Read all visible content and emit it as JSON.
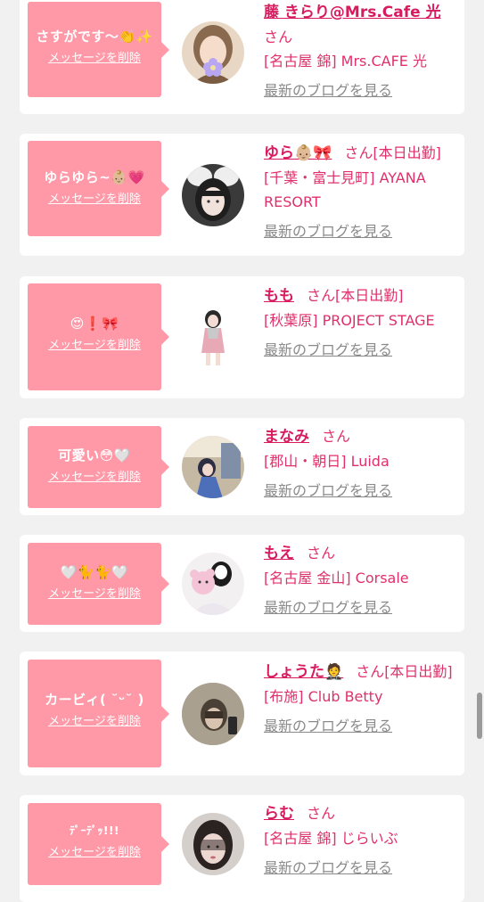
{
  "theme": {
    "bubble_color": "#ff99a8",
    "name_color": "#d81b5f",
    "text_color": "#e0306c",
    "link_gray": "#8a8a8a",
    "page_bg": "#f1f1f1"
  },
  "delete_label": "メッセージを削除",
  "blog_label": "最新のブログを見る",
  "cards": [
    {
      "message": "さすがです〜👏✨",
      "name": "藤 きらり@Mrs.Cafe 光",
      "san": "さん",
      "status": "",
      "shop": "[名古屋 錦] Mrs.CAFE 光",
      "avatar_icon": "girl-face-with-flower-sticker"
    },
    {
      "message": "ゆらゆら~👶🏼💗",
      "name": "ゆら👶🏼🎀",
      "san": "さん",
      "status": "[本日出勤]",
      "shop": "[千葉・富士見町] AYANA RESORT",
      "avatar_icon": "girl-with-fluffy-ears"
    },
    {
      "message": "😍❗🎀",
      "name": "もも",
      "san": "さん",
      "status": "[本日出勤]",
      "shop": "[秋葉原] PROJECT STAGE",
      "avatar_icon": "girl-full-body-pink-dress"
    },
    {
      "message": "可愛い😳🤍",
      "name": "まなみ",
      "san": "さん",
      "status": "",
      "shop": "[郡山・朝日] Luida",
      "avatar_icon": "girl-posing-blue-room"
    },
    {
      "message": "🤍🐈🐈🤍",
      "name": "もえ",
      "san": "さん",
      "status": "",
      "shop": "[名古屋 金山] Corsale",
      "avatar_icon": "girl-with-teddy-bear"
    },
    {
      "message": "カービィ( ˘ᵕ˘ )",
      "name": "しょうた🤵",
      "san": "さん",
      "status": "[本日出勤]",
      "shop": "[布施] Club Betty",
      "avatar_icon": "man-mirror-selfie"
    },
    {
      "message": "ﾃﾟｰﾃﾟｯ!!!",
      "name": "らむ",
      "san": "さん",
      "status": "",
      "shop": "[名古屋 錦] じらいぶ",
      "avatar_icon": "girl-with-lace-veil"
    }
  ]
}
